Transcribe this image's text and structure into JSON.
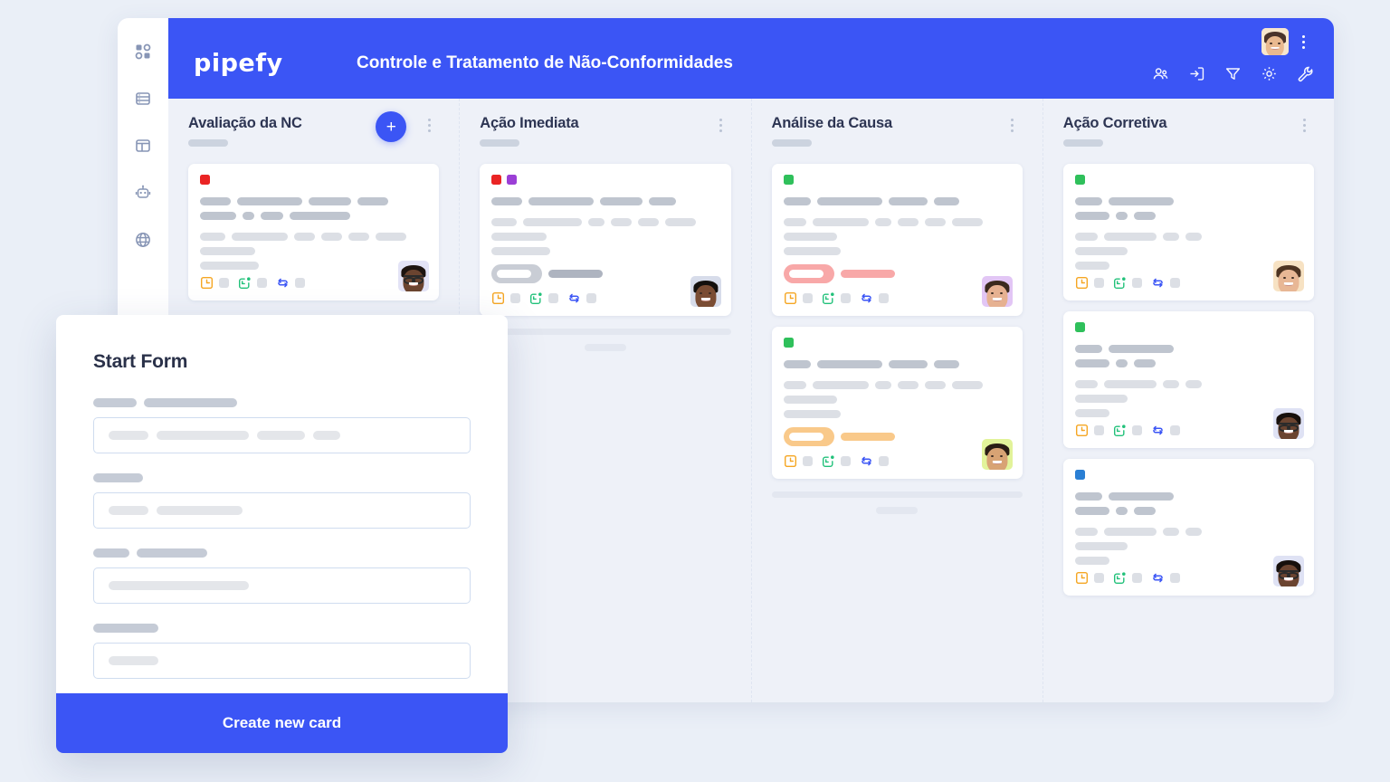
{
  "app": {
    "brand": "pipefy",
    "board_title": "Controle e Tratamento de Não-Conformidades",
    "accent_color": "#3b55f5",
    "page_background": "#eaeff7",
    "board_background": "#eef1f8"
  },
  "sidebar": {
    "items": [
      {
        "icon": "apps-grid-icon",
        "name": "sidebar-item-apps"
      },
      {
        "icon": "database-icon",
        "name": "sidebar-item-database"
      },
      {
        "icon": "layout-panel-icon",
        "name": "sidebar-item-layout"
      },
      {
        "icon": "robot-icon",
        "name": "sidebar-item-automation"
      },
      {
        "icon": "globe-icon",
        "name": "sidebar-item-portal"
      }
    ]
  },
  "topbar": {
    "avatar": {
      "name": "user-avatar",
      "skin": "#e9b98f",
      "hair": "#4a332a",
      "bg": "#f7e6cd"
    },
    "kebab_label": "more-options",
    "actions": [
      {
        "icon": "members-icon",
        "name": "topbar-members-button"
      },
      {
        "icon": "archive-in-icon",
        "name": "topbar-inbox-button"
      },
      {
        "icon": "filter-icon",
        "name": "topbar-filter-button"
      },
      {
        "icon": "gear-icon",
        "name": "topbar-settings-button"
      },
      {
        "icon": "wrench-icon",
        "name": "topbar-tools-button"
      }
    ]
  },
  "board": {
    "columns": [
      {
        "title": "Avaliação da NC",
        "has_add_button": true,
        "add_label": "+",
        "cards": [
          {
            "labels": [
              "#ea2424"
            ],
            "lines": [
              {
                "widths": [
                  34,
                  72,
                  47,
                  34
                ],
                "tone": "dark"
              },
              {
                "widths": [
                  40,
                  13,
                  25,
                  67
                ],
                "tone": "dark"
              },
              {
                "gap": true
              },
              {
                "widths": [
                  28,
                  62,
                  23,
                  23,
                  23,
                  34
                ],
                "tone": "light"
              },
              {
                "widths": [
                  61
                ],
                "tone": "light"
              },
              {
                "widths": [
                  65
                ],
                "tone": "light"
              }
            ],
            "pill": null,
            "avatar": {
              "skin": "#6b4430",
              "hair": "#1d1410",
              "bg": "#e3e3f6",
              "glasses": true
            }
          }
        ],
        "footer": {
          "show": false
        }
      },
      {
        "title": "Ação Imediata",
        "has_add_button": false,
        "cards": [
          {
            "labels": [
              "#ea2424",
              "#9b3fd6"
            ],
            "lines": [
              {
                "widths": [
                  34,
                  72,
                  47,
                  30
                ],
                "tone": "dark"
              },
              {
                "gap": true
              },
              {
                "widths": [
                  28,
                  65,
                  18,
                  23,
                  23,
                  34
                ],
                "tone": "light"
              },
              {
                "widths": [
                  61
                ],
                "tone": "light"
              },
              {
                "widths": [
                  65
                ],
                "tone": "light"
              }
            ],
            "pill": {
              "outline_color": "#c9cdd5",
              "solid_color": "#aeb4c0",
              "outline_w": 56,
              "solid_w": 60
            },
            "avatar": {
              "skin": "#7a4c33",
              "hair": "#14100d",
              "bg": "#d7dcea",
              "glasses": false
            }
          }
        ],
        "footer": {
          "show": true
        }
      },
      {
        "title": "Análise da Causa",
        "has_add_button": false,
        "cards": [
          {
            "labels": [
              "#2fc05b"
            ],
            "lines": [
              {
                "widths": [
                  30,
                  72,
                  43,
                  28
                ],
                "tone": "dark"
              },
              {
                "gap": true
              },
              {
                "widths": [
                  25,
                  62,
                  18,
                  23,
                  23,
                  34
                ],
                "tone": "light"
              },
              {
                "widths": [
                  59
                ],
                "tone": "light"
              },
              {
                "widths": [
                  63
                ],
                "tone": "light"
              }
            ],
            "pill": {
              "outline_color": "#f8a8a8",
              "solid_color": "#f8a8a8",
              "outline_w": 56,
              "solid_w": 60
            },
            "avatar": {
              "skin": "#e6b191",
              "hair": "#3b2a1e",
              "bg": "#e2c6f5",
              "glasses": false
            }
          },
          {
            "labels": [
              "#2fc05b"
            ],
            "lines": [
              {
                "widths": [
                  30,
                  72,
                  43,
                  28
                ],
                "tone": "dark"
              },
              {
                "gap": true
              },
              {
                "widths": [
                  25,
                  62,
                  18,
                  23,
                  23,
                  34
                ],
                "tone": "light"
              },
              {
                "widths": [
                  59
                ],
                "tone": "light"
              },
              {
                "widths": [
                  63
                ],
                "tone": "light"
              }
            ],
            "pill": {
              "outline_color": "#f9c98a",
              "solid_color": "#f9c98a",
              "outline_w": 56,
              "solid_w": 60
            },
            "avatar": {
              "skin": "#d8a374",
              "hair": "#2a1d14",
              "bg": "#e2f39a",
              "glasses": false
            }
          }
        ],
        "footer": {
          "show": true
        }
      },
      {
        "title": "Ação Corretiva",
        "has_add_button": false,
        "cards": [
          {
            "labels": [
              "#2fc05b"
            ],
            "lines": [
              {
                "widths": [
                  30,
                  72
                ],
                "tone": "dark"
              },
              {
                "widths": [
                  38,
                  13,
                  24
                ],
                "tone": "dark"
              },
              {
                "gap": true
              },
              {
                "widths": [
                  25,
                  58,
                  18,
                  18
                ],
                "tone": "light"
              },
              {
                "widths": [
                  58
                ],
                "tone": "light"
              },
              {
                "widths": [
                  38
                ],
                "tone": "light"
              }
            ],
            "pill": null,
            "avatar": {
              "skin": "#e8b795",
              "hair": "#4e3422",
              "bg": "#f7e2c3",
              "glasses": false
            }
          },
          {
            "labels": [
              "#2fc05b"
            ],
            "lines": [
              {
                "widths": [
                  30,
                  72
                ],
                "tone": "dark"
              },
              {
                "widths": [
                  38,
                  13,
                  24
                ],
                "tone": "dark"
              },
              {
                "gap": true
              },
              {
                "widths": [
                  25,
                  58,
                  18,
                  18
                ],
                "tone": "light"
              },
              {
                "widths": [
                  58
                ],
                "tone": "light"
              },
              {
                "widths": [
                  38
                ],
                "tone": "light"
              }
            ],
            "pill": null,
            "avatar": {
              "skin": "#6b4430",
              "hair": "#17100c",
              "bg": "#dfe2f4",
              "glasses": true
            }
          },
          {
            "labels": [
              "#2a7fd4"
            ],
            "lines": [
              {
                "widths": [
                  30,
                  72
                ],
                "tone": "dark"
              },
              {
                "widths": [
                  38,
                  13,
                  24
                ],
                "tone": "dark"
              },
              {
                "gap": true
              },
              {
                "widths": [
                  25,
                  58,
                  18,
                  18
                ],
                "tone": "light"
              },
              {
                "widths": [
                  58
                ],
                "tone": "light"
              },
              {
                "widths": [
                  38
                ],
                "tone": "light"
              }
            ],
            "pill": null,
            "avatar": {
              "skin": "#6b4430",
              "hair": "#17100c",
              "bg": "#dfe2f4",
              "glasses": true
            }
          }
        ],
        "footer": {
          "show": false
        }
      }
    ],
    "card_footer_icons": [
      {
        "icon": "late-clock-icon",
        "color": "#f5a623"
      },
      {
        "icon": "due-date-icon",
        "color": "#21c17a"
      },
      {
        "icon": "connection-loop-icon",
        "color": "#3b55f5"
      }
    ]
  },
  "modal": {
    "title": "Start Form",
    "cta_label": "Create new card",
    "fields": [
      {
        "label_widths": [
          48,
          103
        ],
        "input_widths": [
          44,
          102,
          53,
          30
        ]
      },
      {
        "label_widths": [
          55
        ],
        "input_widths": [
          44,
          95
        ]
      },
      {
        "label_widths": [
          40,
          78
        ],
        "input_widths": [
          155
        ]
      },
      {
        "label_widths": [
          72
        ],
        "input_widths": [
          55
        ]
      }
    ]
  }
}
